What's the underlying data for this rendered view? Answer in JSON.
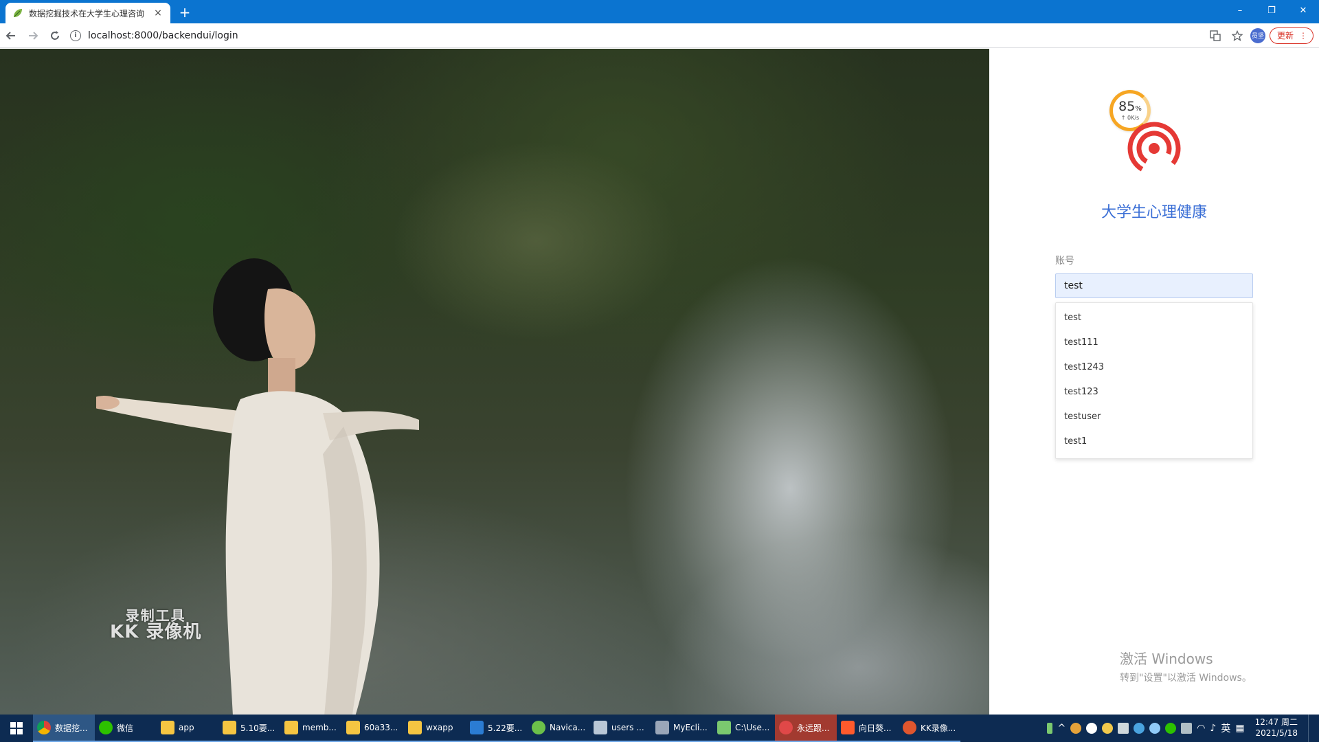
{
  "browser": {
    "tab_title": "数据挖掘技术在大学生心理咨询",
    "tab_close": "×",
    "new_tab": "+",
    "url": "localhost:8000/backendui/login",
    "profile_label": "员坚",
    "update_label": "更新",
    "window": {
      "minimize": "–",
      "restore": "❐",
      "close": "✕"
    }
  },
  "page": {
    "speed_widget": {
      "percent": "85",
      "percent_unit": "%",
      "rate": "↑ 0K/s"
    },
    "app_title": "大学生心理健康",
    "account_label": "账号",
    "account_value": "test",
    "suggestions": [
      "test",
      "test111",
      "test1243",
      "test123",
      "testuser",
      "test1"
    ],
    "watermark": {
      "line1": "录制工具",
      "line2": "KK 录像机"
    },
    "activation": {
      "line1": "激活 Windows",
      "line2": "转到\"设置\"以激活 Windows。"
    }
  },
  "taskbar": {
    "items": [
      {
        "label": "数据挖...",
        "icon": "chrome-icon",
        "color": "#ffffff"
      },
      {
        "label": "微信",
        "icon": "wechat-icon",
        "color": "#2dc100"
      },
      {
        "label": "app",
        "icon": "folder-icon",
        "color": "#f5c542"
      },
      {
        "label": "5.10要...",
        "icon": "folder-icon",
        "color": "#f5c542"
      },
      {
        "label": "memb...",
        "icon": "folder-icon",
        "color": "#f5c542"
      },
      {
        "label": "60a33...",
        "icon": "folder-icon",
        "color": "#f5c542"
      },
      {
        "label": "wxapp",
        "icon": "folder-icon",
        "color": "#f5c542"
      },
      {
        "label": "5.22要...",
        "icon": "word-icon",
        "color": "#2b7cd3"
      },
      {
        "label": "Navica...",
        "icon": "navicat-icon",
        "color": "#6cc04a"
      },
      {
        "label": "users ...",
        "icon": "database-icon",
        "color": "#b9c7d6"
      },
      {
        "label": "MyEcli...",
        "icon": "eclipse-icon",
        "color": "#9aa6b8"
      },
      {
        "label": "C:\\Use...",
        "icon": "notepad-icon",
        "color": "#7bc96f"
      },
      {
        "label": "永远跟...",
        "icon": "player-icon",
        "color": "#e04848"
      },
      {
        "label": "向日葵...",
        "icon": "sunlogin-icon",
        "color": "#ff5a2c"
      },
      {
        "label": "KK录像...",
        "icon": "kk-recorder-icon",
        "color": "#e0562e"
      }
    ],
    "ime": "英",
    "time": "12:47 周二",
    "date": "2021/5/18"
  }
}
